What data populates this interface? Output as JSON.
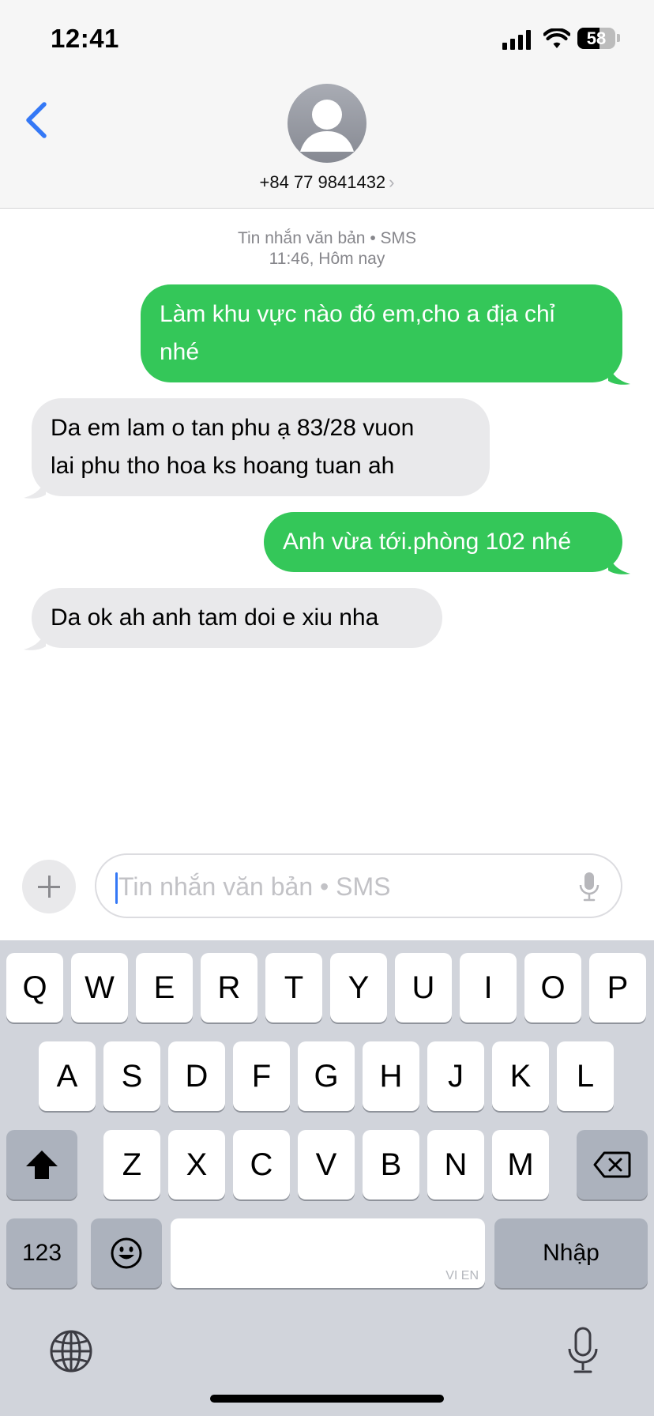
{
  "status_bar": {
    "time": "12:41",
    "battery": "58",
    "battery_level_percent": 58,
    "icons": [
      "cellular-signal-icon",
      "wifi-icon",
      "battery-icon"
    ]
  },
  "header": {
    "contact_number": "+84 77 9841432",
    "chevron": "›",
    "icons": [
      "back-chevron-icon",
      "person-avatar-icon"
    ]
  },
  "conversation": {
    "service_label": "Tin nhắn văn bản • SMS",
    "timestamp": "11:46, Hôm nay",
    "messages": [
      {
        "direction": "outgoing",
        "lines": [
          "Làm khu vực nào đó em,cho a địa chỉ",
          "nhé"
        ]
      },
      {
        "direction": "incoming",
        "lines": [
          "Da em lam o tan phu ạ 83/28 vuon",
          "lai phu tho hoa ks hoang tuan ah"
        ]
      },
      {
        "direction": "outgoing",
        "lines": [
          "Anh vừa tới.phòng 102 nhé"
        ]
      },
      {
        "direction": "incoming",
        "lines": [
          "Da ok ah anh tam doi e xiu nha"
        ]
      }
    ]
  },
  "composer": {
    "placeholder": "Tin nhắn văn bản • SMS",
    "icons": [
      "plus-icon",
      "microphone-icon"
    ]
  },
  "keyboard": {
    "row1": [
      "Q",
      "W",
      "E",
      "R",
      "T",
      "Y",
      "U",
      "I",
      "O",
      "P"
    ],
    "row2": [
      "A",
      "S",
      "D",
      "F",
      "G",
      "H",
      "J",
      "K",
      "L"
    ],
    "row3": [
      "Z",
      "X",
      "C",
      "V",
      "B",
      "N",
      "M"
    ],
    "numbers_key": "123",
    "return_key": "Nhập",
    "space_hint": "VI EN",
    "icons": [
      "shift-icon",
      "delete-icon",
      "emoji-icon",
      "globe-icon",
      "dictation-mic-icon"
    ],
    "colors": {
      "background": "#d1d4db",
      "key": "#ffffff",
      "function_key": "#acb2bd"
    }
  },
  "colors": {
    "outgoing_bubble": "#34c759",
    "incoming_bubble": "#e9e9eb",
    "accent": "#3478f6"
  }
}
